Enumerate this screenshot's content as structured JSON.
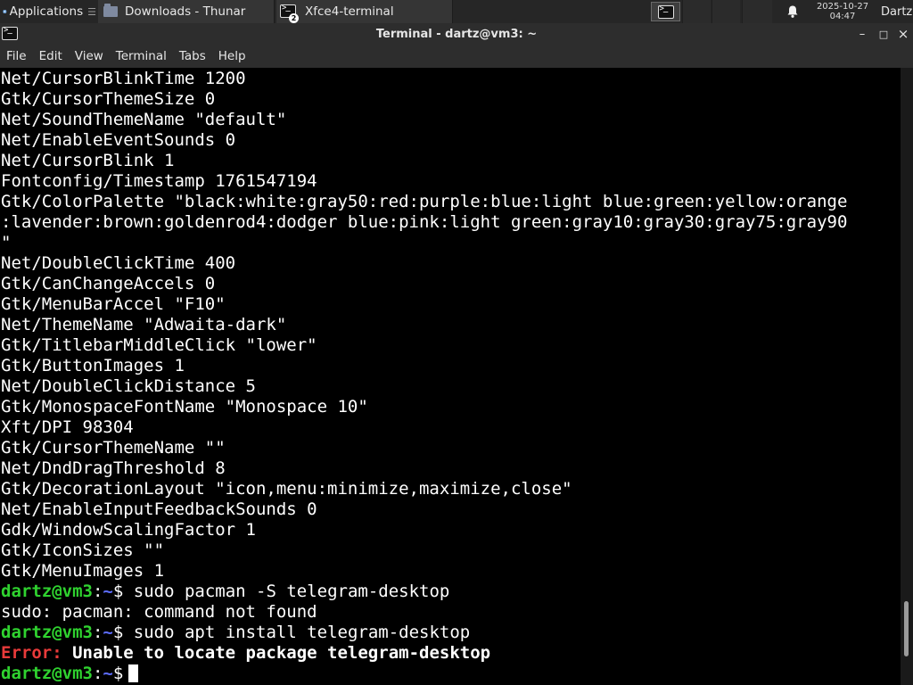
{
  "panel": {
    "applications_label": "Applications",
    "applications_sep": "☰",
    "tasks": [
      {
        "label": "Downloads - Thunar",
        "icon": "folder-icon"
      },
      {
        "label": "Xfce4-terminal",
        "icon": "terminal-icon",
        "badge": "2"
      }
    ],
    "clock": {
      "date": "2025-10-27",
      "time": "04:47"
    },
    "user": "Dartz"
  },
  "window": {
    "title": "Terminal - dartz@vm3: ~",
    "controls": {
      "minimize": "–",
      "maximize": "□",
      "close": "×"
    }
  },
  "menubar": {
    "items": [
      "File",
      "Edit",
      "View",
      "Terminal",
      "Tabs",
      "Help"
    ]
  },
  "terminal": {
    "prompt": {
      "user_host": "dartz@vm3",
      "sep": ":",
      "path": "~",
      "symbol": "$ "
    },
    "lines": [
      {
        "kind": "out",
        "text": "Net/CursorBlinkTime 1200"
      },
      {
        "kind": "out",
        "text": "Gtk/CursorThemeSize 0"
      },
      {
        "kind": "out",
        "text": "Net/SoundThemeName \"default\""
      },
      {
        "kind": "out",
        "text": "Net/EnableEventSounds 0"
      },
      {
        "kind": "out",
        "text": "Net/CursorBlink 1"
      },
      {
        "kind": "out",
        "text": "Fontconfig/Timestamp 1761547194"
      },
      {
        "kind": "out",
        "text": "Gtk/ColorPalette \"black:white:gray50:red:purple:blue:light blue:green:yellow:orange"
      },
      {
        "kind": "out",
        "text": ":lavender:brown:goldenrod4:dodger blue:pink:light green:gray10:gray30:gray75:gray90"
      },
      {
        "kind": "out",
        "text": "\""
      },
      {
        "kind": "out",
        "text": "Net/DoubleClickTime 400"
      },
      {
        "kind": "out",
        "text": "Gtk/CanChangeAccels 0"
      },
      {
        "kind": "out",
        "text": "Gtk/MenuBarAccel \"F10\""
      },
      {
        "kind": "out",
        "text": "Net/ThemeName \"Adwaita-dark\""
      },
      {
        "kind": "out",
        "text": "Gtk/TitlebarMiddleClick \"lower\""
      },
      {
        "kind": "out",
        "text": "Gtk/ButtonImages 1"
      },
      {
        "kind": "out",
        "text": "Net/DoubleClickDistance 5"
      },
      {
        "kind": "out",
        "text": "Gtk/MonospaceFontName \"Monospace 10\""
      },
      {
        "kind": "out",
        "text": "Xft/DPI 98304"
      },
      {
        "kind": "out",
        "text": "Gtk/CursorThemeName \"\""
      },
      {
        "kind": "out",
        "text": "Net/DndDragThreshold 8"
      },
      {
        "kind": "out",
        "text": "Gtk/DecorationLayout \"icon,menu:minimize,maximize,close\""
      },
      {
        "kind": "out",
        "text": "Net/EnableInputFeedbackSounds 0"
      },
      {
        "kind": "out",
        "text": "Gdk/WindowScalingFactor 1"
      },
      {
        "kind": "out",
        "text": "Gtk/IconSizes \"\""
      },
      {
        "kind": "out",
        "text": "Gtk/MenuImages 1"
      },
      {
        "kind": "cmd",
        "text": "sudo pacman -S telegram-desktop"
      },
      {
        "kind": "out",
        "text": "sudo: pacman: command not found"
      },
      {
        "kind": "cmd",
        "text": "sudo apt install telegram-desktop"
      },
      {
        "kind": "err",
        "label": "Error:",
        "text": " Unable to locate package telegram-desktop"
      },
      {
        "kind": "prompt",
        "text": ""
      }
    ]
  },
  "scrollbar": {
    "position": 0.95,
    "visible_fraction": 0.09
  },
  "colors": {
    "prompt_user": "#2fd22f",
    "prompt_path": "#5c6cff",
    "error": "#e83a3a",
    "panel_bg": "#262626",
    "titlebar_bg": "#2d2d2d"
  }
}
